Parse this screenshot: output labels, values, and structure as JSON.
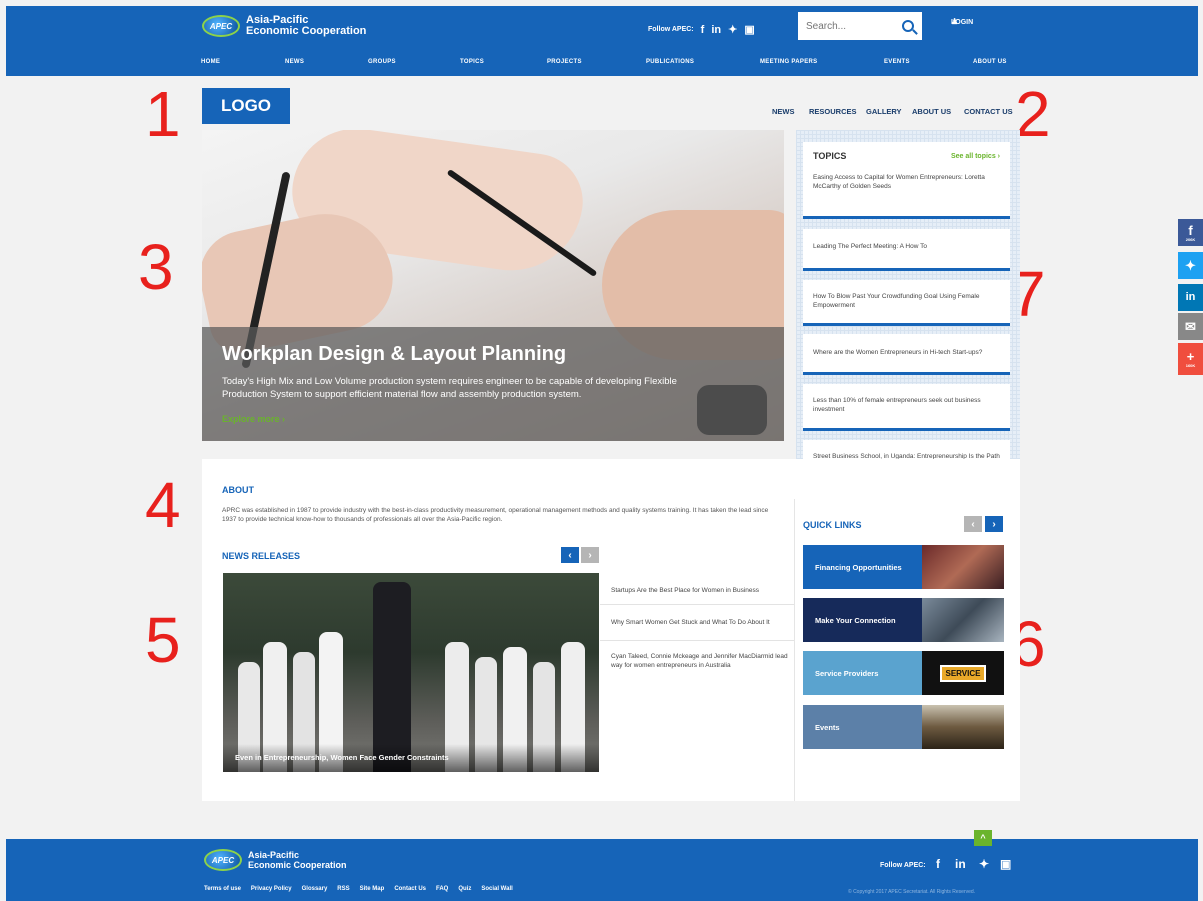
{
  "header": {
    "org_line1": "Asia-Pacific",
    "org_line2": "Economic Cooperation",
    "badge": "APEC",
    "follow_label": "Follow APEC:",
    "social": [
      "f",
      "in",
      "t",
      "yt"
    ],
    "search_placeholder": "Search...",
    "login_label": "LOGIN",
    "nav": [
      "HOME",
      "NEWS",
      "GROUPS",
      "TOPICS",
      "PROJECTS",
      "PUBLICATIONS",
      "MEETING PAPERS",
      "EVENTS",
      "ABOUT US"
    ]
  },
  "annotations": [
    "1",
    "2",
    "3",
    "4",
    "5",
    "6",
    "7"
  ],
  "site": {
    "logo": "LOGO",
    "subnav": [
      "NEWS",
      "RESOURCES",
      "GALLERY",
      "ABOUT US",
      "CONTACT US"
    ]
  },
  "hero": {
    "title": "Workplan Design & Layout Planning",
    "text": "Today's High Mix and Low Volume production system requires engineer to be capable of developing Flexible Production System to support efficient material flow and assembly production system.",
    "cta": "Explore more  ›"
  },
  "topics": {
    "title": "TOPICS",
    "see_all": "See all topics  ›",
    "items": [
      "Easing Access to Capital for Women Entrepreneurs: Loretta McCarthy of Golden Seeds",
      "Leading The Perfect Meeting: A How To",
      "How To Blow Past Your Crowdfunding Goal Using Female Empowerment",
      "Where are the Women Entrepreneurs in Hi-tech Start-ups?",
      "Less than 10% of female entrepreneurs seek out business investment",
      "Street Business School, in Uganda: Entrepreneurship Is the Path out of Poverty"
    ]
  },
  "about": {
    "title": "ABOUT",
    "text": "APRC was established in 1987 to provide industry with the best-in-class productivity measurement, operational management methods and quality systems training. It has taken the lead since 1937 to provide technical know-how to thousands of professionals all over the Asia-Pacific region."
  },
  "news": {
    "title": "NEWS RELEASES",
    "photo_caption": "Even in Entrepreneurship, Women Face Gender Constraints",
    "items": [
      "Startups Are the Best Place for Women in Business",
      "Why Smart Women Get Stuck and What To Do About It",
      "Cyan Taleed, Connie Mckeage and Jennifer MacDiarmid lead way for women entrepreneurs in Australia"
    ],
    "prev": "‹",
    "next": "›"
  },
  "quick_links": {
    "title": "QUICK LINKS",
    "items": [
      {
        "label": "Financing Opportunities",
        "color": "#1664b8"
      },
      {
        "label": "Make Your Connection",
        "color": "#162a5a"
      },
      {
        "label": "Service Providers",
        "color": "#5aa3cf"
      },
      {
        "label": "Events",
        "color": "#5c80a8"
      }
    ],
    "service_sign": "SERVICE"
  },
  "side_social": [
    {
      "icon": "f",
      "count": "206K",
      "color": "#3b5998"
    },
    {
      "icon": "t",
      "count": "",
      "color": "#1da1f2"
    },
    {
      "icon": "in",
      "count": "",
      "color": "#0077b5"
    },
    {
      "icon": "✉",
      "count": "",
      "color": "#888888"
    },
    {
      "icon": "+",
      "count": "160K",
      "color": "#f04e3e"
    }
  ],
  "footer": {
    "org_line1": "Asia-Pacific",
    "org_line2": "Economic Cooperation",
    "follow_label": "Follow APEC:",
    "links": [
      "Terms of use",
      "Privacy Policy",
      "Glossary",
      "RSS",
      "Site Map",
      "Contact Us",
      "FAQ",
      "Quiz",
      "Social Wall"
    ],
    "copyright": "© Copyright 2017 APEC Secretariat. All Rights Reserved.",
    "to_top": "^"
  }
}
